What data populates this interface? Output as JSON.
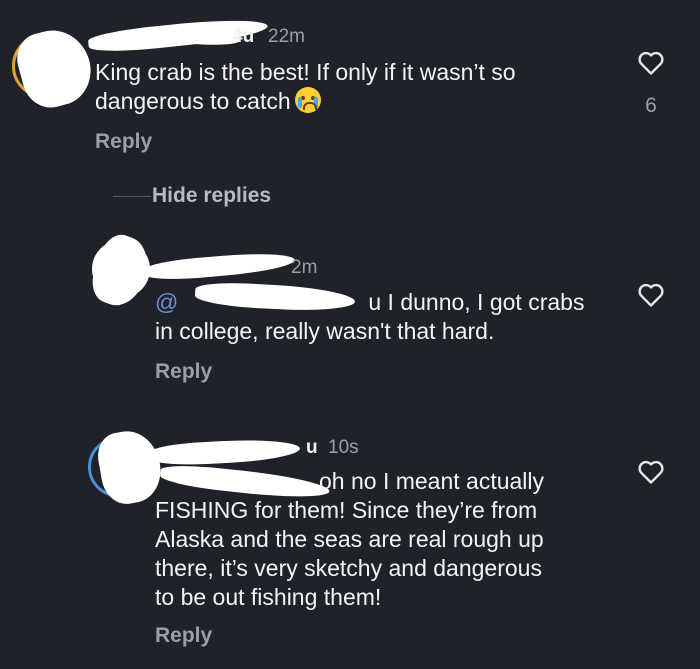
{
  "comments": [
    {
      "time": "22m",
      "lines": [
        "King crab is the best! If only if it wasn’t so",
        "dangerous to catch"
      ],
      "emoji": "loudly-crying-face",
      "likes": "6",
      "reply_label": "Reply"
    }
  ],
  "hide_replies_label": "Hide replies",
  "replies": [
    {
      "time": "2m",
      "mention": "@",
      "lines": [
        "u I dunno, I got crabs",
        "in college, really wasn't that hard."
      ],
      "reply_label": "Reply"
    },
    {
      "username_suffix": "u",
      "time": "10s",
      "lines": [
        "oh no I meant actually",
        "FISHING for them! Since they’re from",
        "Alaska and the seas are real rough up",
        "there, it’s very sketchy and dangerous",
        "to be out fishing them!"
      ],
      "reply_label": "Reply"
    }
  ],
  "colors": {
    "background": "#1f2228",
    "mention": "#6d8fd6",
    "secondary_text": "#9aa0a8",
    "story_ring": "#e1a23a"
  },
  "icons": [
    "heart-icon",
    "loudly-crying-face"
  ]
}
